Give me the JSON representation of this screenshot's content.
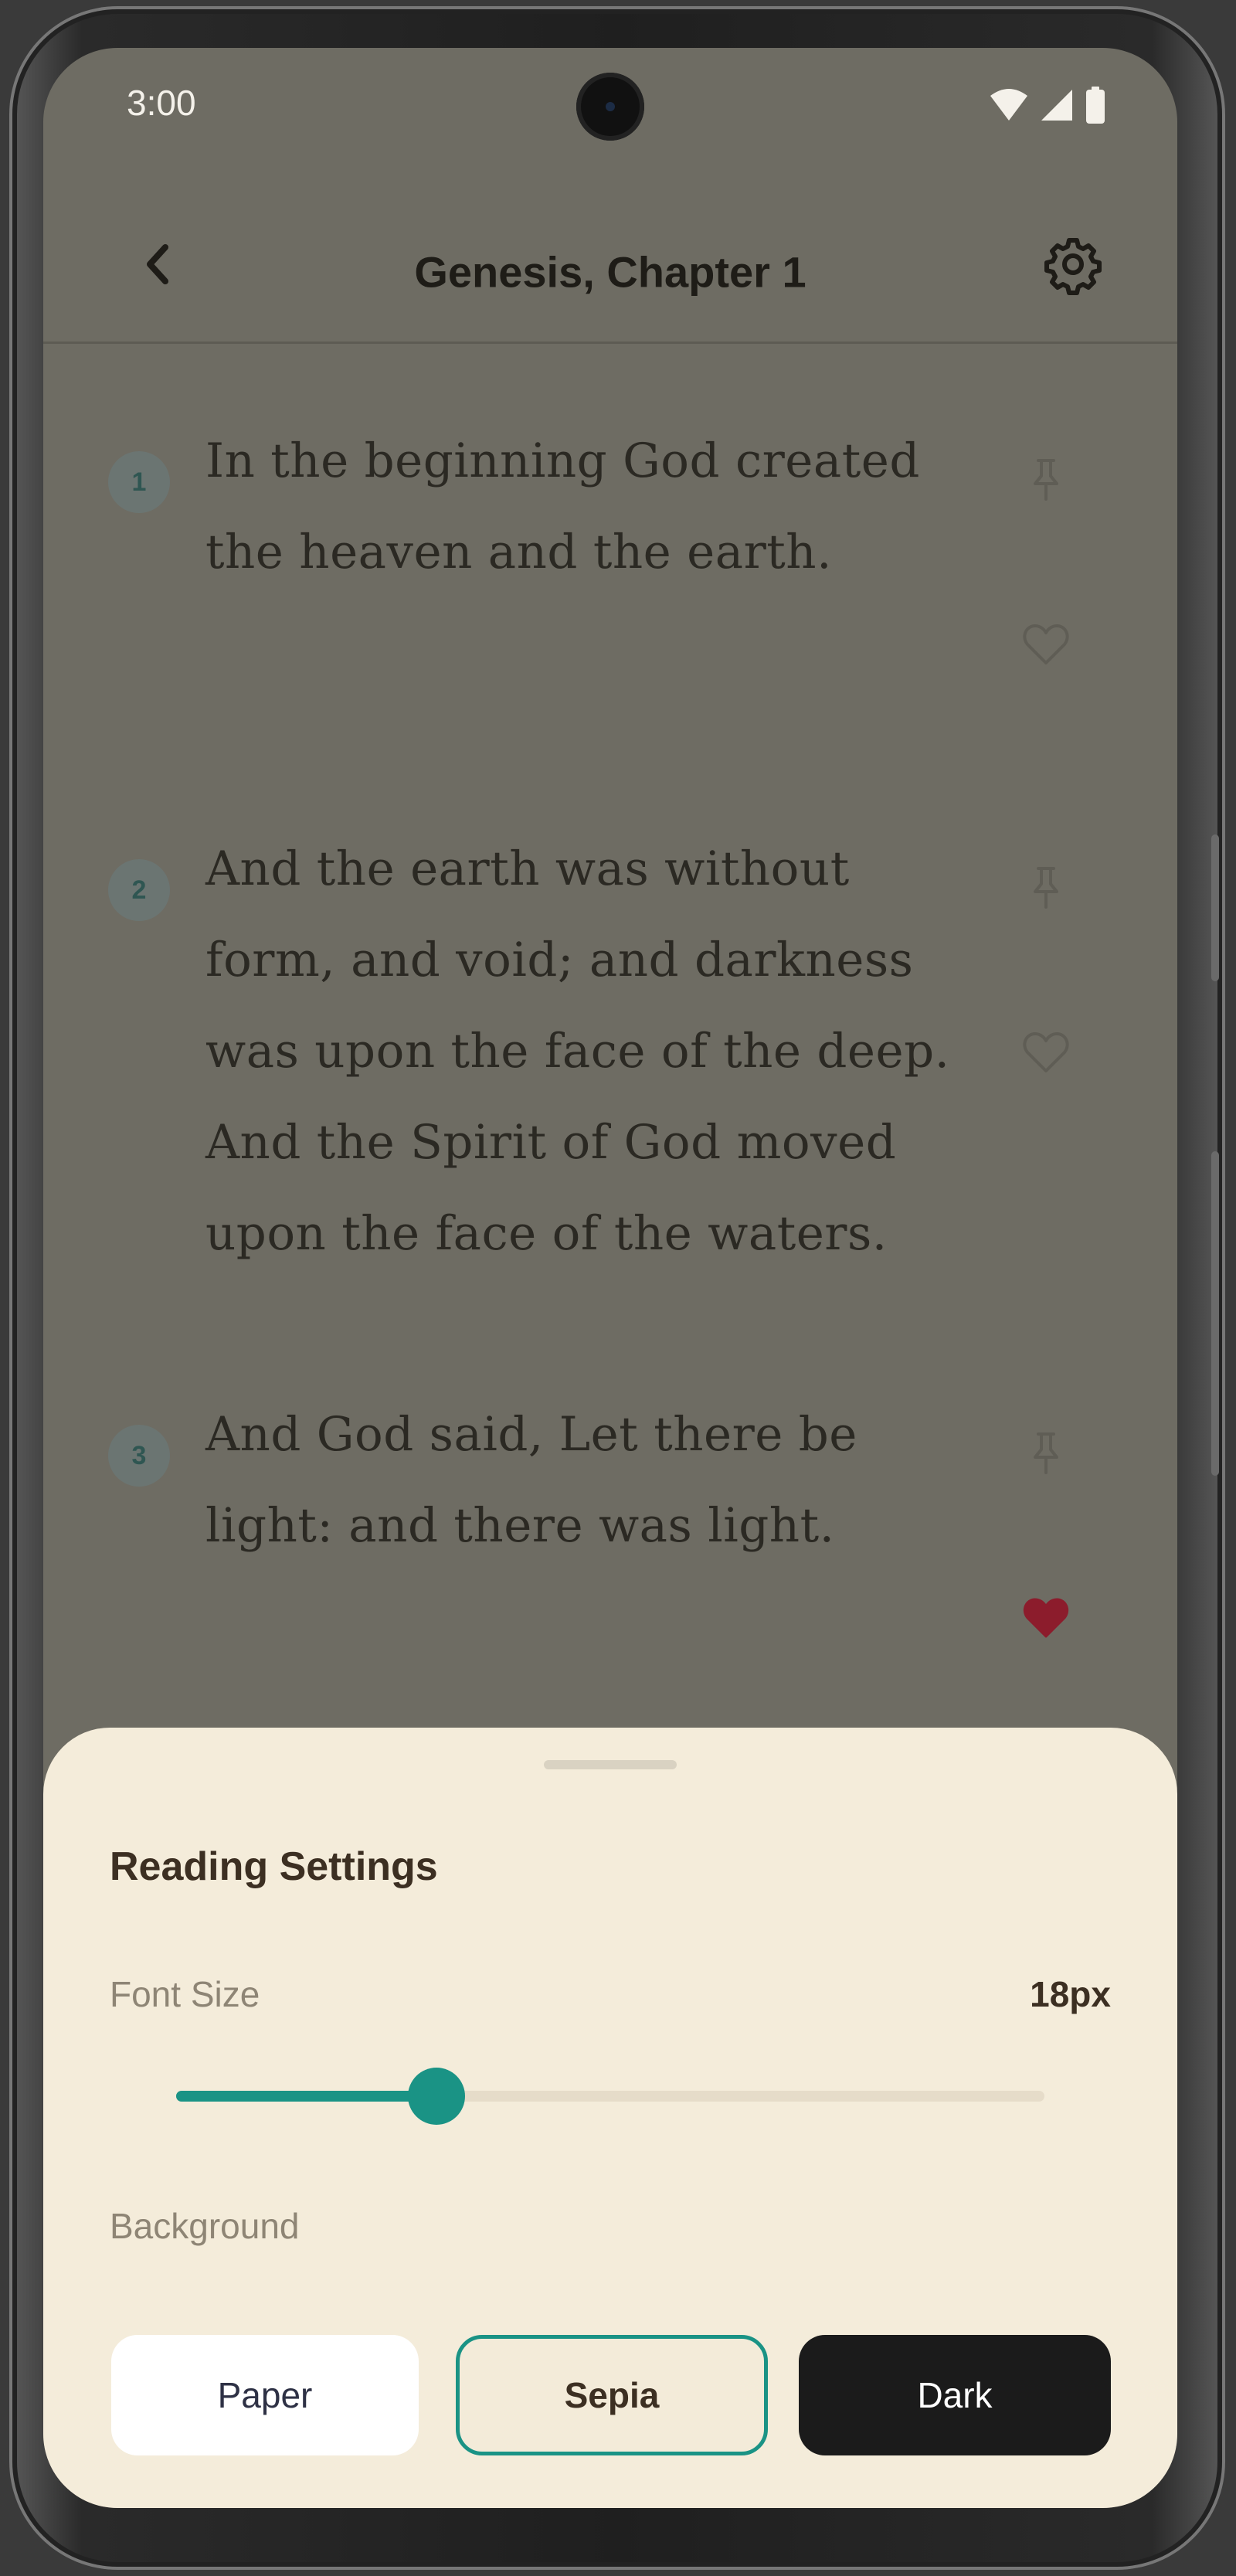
{
  "status_bar": {
    "time": "3:00"
  },
  "app_bar": {
    "title": "Genesis, Chapter 1"
  },
  "verses": [
    {
      "number": "1",
      "text": "In the beginning God created the heaven and the earth.",
      "favorited": false
    },
    {
      "number": "2",
      "text": "And the earth was without form, and void; and darkness was upon the face of the deep. And the Spirit of God moved upon the face of the waters.",
      "favorited": false
    },
    {
      "number": "3",
      "text": "And God said, Let there be light: and there was light.",
      "favorited": true
    }
  ],
  "settings_sheet": {
    "title": "Reading Settings",
    "font_size_label": "Font Size",
    "font_size_value": "18px",
    "font_size_slider_fraction": 0.3,
    "background_label": "Background",
    "background_options": [
      "Paper",
      "Sepia",
      "Dark"
    ],
    "selected_background": "Sepia"
  },
  "colors": {
    "accent": "#1a9385",
    "favorite_heart": "#8c1c2c",
    "sheet_background": "#f4ecda",
    "dimmed_page": "#6e6c63"
  },
  "icons": {
    "back": "chevron-left-icon",
    "settings": "gear-icon",
    "pin": "pin-icon",
    "favorite": "heart-icon",
    "wifi": "wifi-icon",
    "signal": "signal-icon",
    "battery": "battery-icon"
  }
}
